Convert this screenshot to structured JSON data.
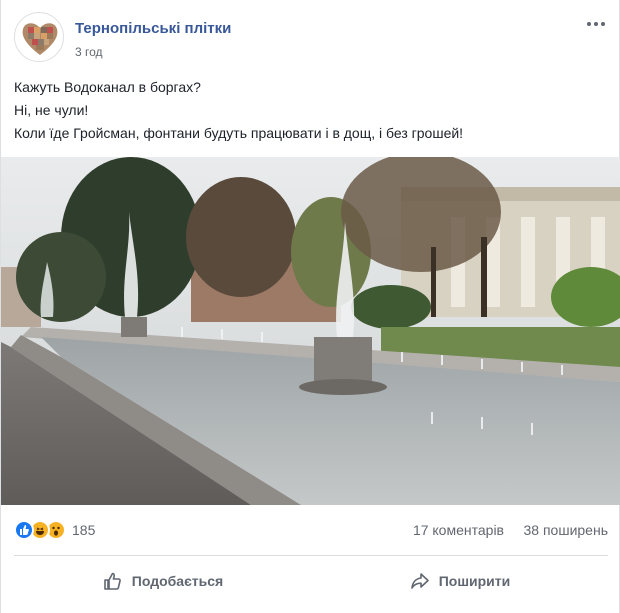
{
  "post": {
    "page_name": "Тернопільські плітки",
    "timestamp": "3 год",
    "text_lines": [
      "Кажуть Водоканал в боргах?",
      "Ні, не чули!",
      "Коли їде Гройсман, фонтани будуть працювати і в дощ, і без грошей!"
    ]
  },
  "stats": {
    "reactions": [
      "like",
      "haha",
      "wow"
    ],
    "reaction_count": "185",
    "comments": "17 коментарів",
    "shares": "38 поширень"
  },
  "actions": {
    "like_label": "Подобається",
    "share_label": "Поширити"
  },
  "colors": {
    "link": "#385898",
    "like_blue": "#1877f2",
    "reaction_yellow": "#f7b125",
    "meta_gray": "#616770"
  }
}
